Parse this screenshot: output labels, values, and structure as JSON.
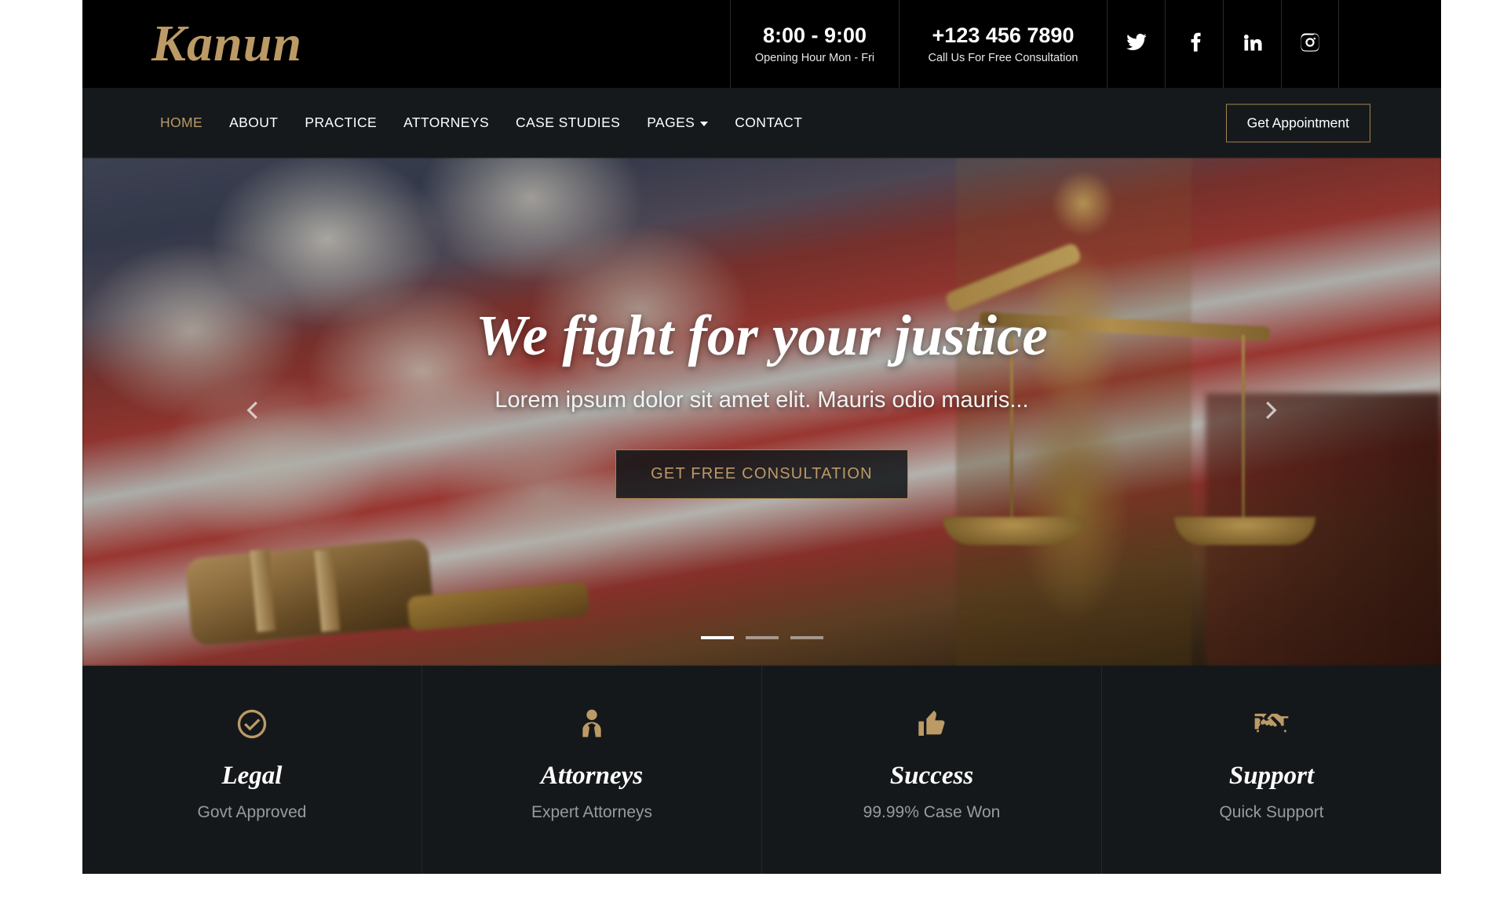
{
  "brand": {
    "name": "Kanun"
  },
  "topbar": {
    "hours": {
      "value": "8:00 - 9:00",
      "label": "Opening Hour Mon - Fri"
    },
    "phone": {
      "value": "+123 456 7890",
      "label": "Call Us For Free Consultation"
    },
    "socials": [
      {
        "name": "twitter-icon",
        "label": "Twitter"
      },
      {
        "name": "facebook-icon",
        "label": "Facebook"
      },
      {
        "name": "linkedin-icon",
        "label": "LinkedIn"
      },
      {
        "name": "instagram-icon",
        "label": "Instagram"
      }
    ]
  },
  "nav": {
    "items": [
      {
        "label": "HOME",
        "active": true,
        "dropdown": false
      },
      {
        "label": "ABOUT",
        "active": false,
        "dropdown": false
      },
      {
        "label": "PRACTICE",
        "active": false,
        "dropdown": false
      },
      {
        "label": "ATTORNEYS",
        "active": false,
        "dropdown": false
      },
      {
        "label": "CASE STUDIES",
        "active": false,
        "dropdown": false
      },
      {
        "label": "PAGES",
        "active": false,
        "dropdown": true
      },
      {
        "label": "CONTACT",
        "active": false,
        "dropdown": false
      }
    ],
    "appointment_button": "Get Appointment",
    "active_color": "#bc9a66",
    "accent_color": "#a5834f"
  },
  "hero": {
    "title": "We fight for your justice",
    "subtitle": "Lorem ipsum dolor sit amet elit. Mauris odio mauris...",
    "cta_label": "GET FREE CONSULTATION",
    "prev_label": "Previous slide",
    "next_label": "Next slide",
    "slides": [
      {
        "index": 1,
        "active": true
      },
      {
        "index": 2,
        "active": false
      },
      {
        "index": 3,
        "active": false
      }
    ]
  },
  "features": [
    {
      "icon": "check-circle-icon",
      "title": "Legal",
      "desc": "Govt Approved"
    },
    {
      "icon": "user-tie-icon",
      "title": "Attorneys",
      "desc": "Expert Attorneys"
    },
    {
      "icon": "thumbs-up-icon",
      "title": "Success",
      "desc": "99.99% Case Won"
    },
    {
      "icon": "handshake-icon",
      "title": "Support",
      "desc": "Quick Support"
    }
  ],
  "colors": {
    "gold": "#bc9a66",
    "gold_border": "#a5834f",
    "nav_bg": "#15191c",
    "feature_bg": "#14181b",
    "topbar_bg": "#000000"
  }
}
